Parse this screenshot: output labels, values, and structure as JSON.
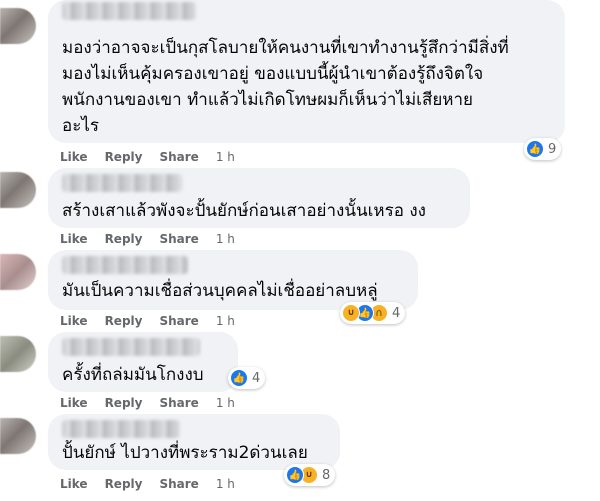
{
  "actions": {
    "like": "Like",
    "reply": "Reply",
    "share": "Share"
  },
  "comments": [
    {
      "text": "มองว่าอาจจะเป็นกุสโลบายให้คนงานที่เขาทำงานรู้สึกว่ามีสิ่งที่\nมองไม่เห็นคุ้มครองเขาอยู่ ของแบบนี้ผู้นำเขาต้องรู้ถึงจิตใจ\nพนักงานของเขา ทำแล้วไม่เกิดโทษผมก็เห็นว่าไม่เสียหาย\nอะไร",
      "time": "1 h",
      "reactions": [
        "like-icon"
      ],
      "count": "9"
    },
    {
      "text": "สร้างเสาแล้วพังจะปั้นยักษ์ก่อนเสาอย่างนั้นเหรอ งง",
      "time": "1 h",
      "reactions": [],
      "count": ""
    },
    {
      "text": "มันเป็นความเชื่อส่วนบุคคลไม่เชื่ออย่าลบหลู่",
      "time": "1 h",
      "reactions": [
        "haha-icon",
        "like-icon",
        "sad-icon"
      ],
      "count": "4"
    },
    {
      "text": "ครั้งที่ถล่มมันโกงงบ",
      "time": "1 h",
      "reactions": [
        "like-icon"
      ],
      "count": "4"
    },
    {
      "text": "ปั้นยักษ์ ไปวางที่พระราม2ด่วนเลย",
      "time": "1 h",
      "reactions": [
        "like-icon",
        "haha-icon"
      ],
      "count": "8"
    }
  ]
}
